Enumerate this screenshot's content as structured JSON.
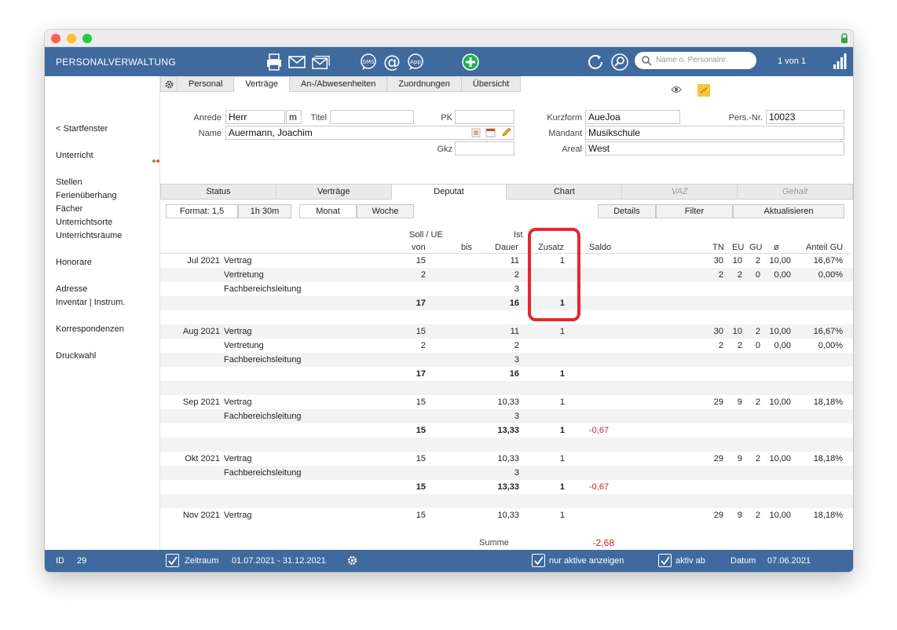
{
  "app": {
    "title": "PERSONALVERWALTUNG",
    "pager": "1 von 1",
    "search_placeholder": "Name o. Personalnr."
  },
  "sidebar": {
    "back": "< Startfenster",
    "items": [
      "Unterricht",
      "Stellen",
      "Ferienüberhang",
      "Fächer",
      "Unterrichtsorte",
      "Unterrichtsräume",
      "Honorare",
      "Adresse",
      "Inventar | Instrum.",
      "Korrespondenzen",
      "Druckwahl"
    ],
    "dot_colors": [
      "#888888",
      "#e0552a"
    ]
  },
  "top_tabs": [
    "Personal",
    "Verträge",
    "An-/Abwesenheiten",
    "Zuordnungen",
    "Übersicht"
  ],
  "form": {
    "anrede_label": "Anrede",
    "anrede": "Herr",
    "gender": "m",
    "titel_label": "Titel",
    "titel": "",
    "pk_label": "PK",
    "pk": "",
    "name_label": "Name",
    "name": "Auermann, Joachim",
    "gkz_label": "Gkz",
    "gkz": "",
    "kurzform_label": "Kurzform",
    "kurzform": "AueJoa",
    "persnr_label": "Pers.-Nr.",
    "persnr": "10023",
    "mandant_label": "Mandant",
    "mandant": "Musikschule",
    "areal_label": "Areal",
    "areal": "West"
  },
  "sub_tabs": [
    "Status",
    "Verträge",
    "Deputat",
    "Chart",
    "VAZ",
    "Gehalt"
  ],
  "controls": {
    "format": "Format: 1,5",
    "hours": "1h 30m",
    "monat": "Monat",
    "woche": "Woche",
    "details": "Details",
    "filter": "Filter",
    "aktualisieren": "Aktualisieren"
  },
  "table": {
    "h_soll": "Soll / UE",
    "h_ist": "Ist",
    "h_von": "von",
    "h_bis": "bis",
    "h_dauer": "Dauer",
    "h_zusatz": "Zusatz",
    "h_saldo": "Saldo",
    "h_tn": "TN",
    "h_eu": "EU",
    "h_gu": "GU",
    "h_avg": "ø",
    "h_anteil": "Anteil GU",
    "rows": [
      {
        "month": "Jul 2021",
        "type": "Vertrag",
        "von": "15",
        "dauer": "11",
        "zusatz": "1",
        "tn": "30",
        "eu": "10",
        "gu": "2",
        "avg": "10,00",
        "anteil": "16,67%"
      },
      {
        "type": "Vertretung",
        "von": "2",
        "dauer": "2",
        "tn": "2",
        "eu": "2",
        "gu": "0",
        "avg": "0,00",
        "anteil": "0,00%"
      },
      {
        "type": "Fachbereichsleitung",
        "dauer": "3"
      },
      {
        "total": true,
        "von": "17",
        "dauer": "16",
        "zusatz": "1"
      },
      {
        "blank": true
      },
      {
        "month": "Aug 2021",
        "type": "Vertrag",
        "von": "15",
        "dauer": "11",
        "zusatz": "1",
        "tn": "30",
        "eu": "10",
        "gu": "2",
        "avg": "10,00",
        "anteil": "16,67%"
      },
      {
        "type": "Vertretung",
        "von": "2",
        "dauer": "2",
        "tn": "2",
        "eu": "2",
        "gu": "0",
        "avg": "0,00",
        "anteil": "0,00%"
      },
      {
        "type": "Fachbereichsleitung",
        "dauer": "3"
      },
      {
        "total": true,
        "von": "17",
        "dauer": "16",
        "zusatz": "1"
      },
      {
        "blank": true
      },
      {
        "month": "Sep 2021",
        "type": "Vertrag",
        "von": "15",
        "dauer": "10,33",
        "zusatz": "1",
        "tn": "29",
        "eu": "9",
        "gu": "2",
        "avg": "10,00",
        "anteil": "18,18%"
      },
      {
        "type": "Fachbereichsleitung",
        "dauer": "3"
      },
      {
        "total": true,
        "von": "15",
        "dauer": "13,33",
        "zusatz": "1",
        "saldo": "-0,67"
      },
      {
        "blank": true
      },
      {
        "month": "Okt 2021",
        "type": "Vertrag",
        "von": "15",
        "dauer": "10,33",
        "zusatz": "1",
        "tn": "29",
        "eu": "9",
        "gu": "2",
        "avg": "10,00",
        "anteil": "18,18%"
      },
      {
        "type": "Fachbereichsleitung",
        "dauer": "3"
      },
      {
        "total": true,
        "von": "15",
        "dauer": "13,33",
        "zusatz": "1",
        "saldo": "-0,67"
      },
      {
        "blank": true
      },
      {
        "month": "Nov 2021",
        "type": "Vertrag",
        "von": "15",
        "dauer": "10,33",
        "zusatz": "1",
        "tn": "29",
        "eu": "9",
        "gu": "2",
        "avg": "10,00",
        "anteil": "18,18%"
      }
    ],
    "summe_label": "Summe",
    "summe": "-2,68"
  },
  "status": {
    "id_label": "ID",
    "id": "29",
    "zeitraum_label": "Zeitraum",
    "zeitraum": "01.07.2021  -  31.12.2021",
    "nur_aktive": "nur aktive anzeigen",
    "aktiv_ab": "aktiv ab",
    "datum_label": "Datum",
    "datum": "07.06.2021"
  },
  "colors": {
    "brand": "#3f6a9e",
    "negative": "#c0282d",
    "highlight": "#e8262e"
  }
}
